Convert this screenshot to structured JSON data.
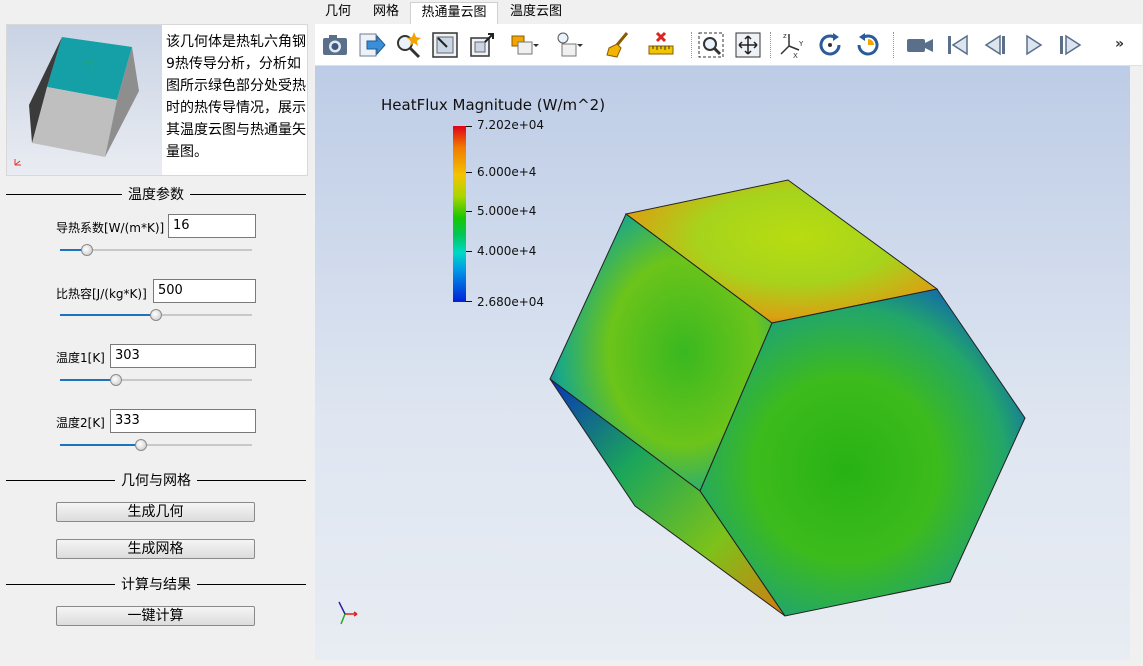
{
  "preview": {
    "description": "该几何体是热轧六角钢9热传导分析，分析如图所示绿色部分处受热时的热传导情况，展示其温度云图与热通量矢量图。"
  },
  "sections": {
    "temperature": "温度参数",
    "geometry": "几何与网格",
    "compute": "计算与结果"
  },
  "params": [
    {
      "label": "导热系数[W/(m*K)]",
      "value": "16",
      "slider": 0.14
    },
    {
      "label": "比热容[J/(kg*K)]",
      "value": "500",
      "slider": 0.5
    },
    {
      "label": "温度1[K]",
      "value": "303",
      "slider": 0.29
    },
    {
      "label": "温度2[K]",
      "value": "333",
      "slider": 0.42
    }
  ],
  "buttons": {
    "gen_geometry": "生成几何",
    "gen_mesh": "生成网格",
    "compute": "一键计算"
  },
  "tabs": [
    {
      "label": "几何"
    },
    {
      "label": "网格"
    },
    {
      "label": "热通量云图",
      "active": true
    },
    {
      "label": "温度云图"
    }
  ],
  "toolbar": {
    "icons": [
      "camera-icon",
      "export-icon",
      "magic-zoom-icon",
      "fit-view-icon",
      "zoom-box-icon",
      "display-mode-icon",
      "light-icon",
      "clear-brush-icon",
      "measure-icon",
      "zoom-region-icon",
      "pan-icon",
      "axes-icon",
      "rotate-cw-icon",
      "rotate-ccw-icon",
      "video-icon",
      "first-frame-icon",
      "prev-frame-icon",
      "play-icon",
      "next-frame-icon"
    ],
    "more": "»"
  },
  "legend": {
    "title": "HeatFlux Magnitude (W/m^2)",
    "labels": [
      "7.202e+04",
      "6.000e+4",
      "5.000e+4",
      "4.000e+4",
      "2.680e+04"
    ],
    "max": 72020,
    "min": 26800
  },
  "colors": {
    "accent": "#1e73be",
    "model_top": "#0f9aa0",
    "panel_bg": "#f0f0f0"
  }
}
